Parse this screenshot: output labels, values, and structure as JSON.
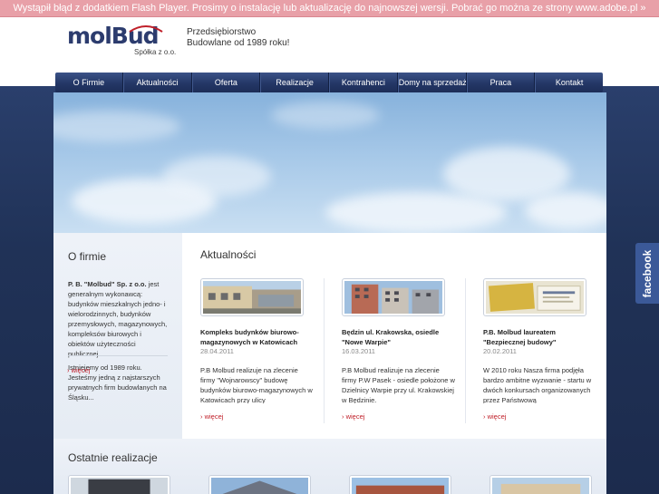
{
  "flash": {
    "message": "Wystąpił błąd z dodatkiem Flash Player. Prosimy o instalację lub aktualizację do najnowszej wersji. Pobrać go można ze strony",
    "link": "www.adobe.pl",
    "arrow": "»"
  },
  "header": {
    "logo_main": "mol",
    "logo_b": "B",
    "logo_rest": "ud",
    "logo_sub": "Spółka z o.o.",
    "tagline": "Przedsiębiorstwo Budowlane od 1989 roku!"
  },
  "nav": [
    "O Firmie",
    "Aktualności",
    "Oferta",
    "Realizacje",
    "Kontrahenci",
    "Domy na sprzedaż",
    "Praca",
    "Kontakt"
  ],
  "sidebar": {
    "title": "O firmie",
    "p1_bold": "P. B. \"Molbud\" Sp. z o.o.",
    "p1": " jest generalnym wykonawcą: budynków mieszkalnych jedno- i wielorodzinnych, budynków przemysłowych, magazynowych, kompleksów biurowych i obiektów użyteczności publicznej.",
    "p2": "Istniejemy od 1989 roku. Jesteśmy jedną z najstarszych prywatnych firm budowlanych na Śląsku...",
    "more": "› więcej"
  },
  "news": {
    "title": "Aktualności",
    "items": [
      {
        "headline": "Kompleks budynków biurowo-magazynowych w Katowicach",
        "date": "28.04.2011",
        "text": "P.B Molbud realizuje na zlecenie firmy \"Wojnarowscy\" budowę budynków biurowo-magazynowych w Katowicach przy ulicy",
        "more": "› więcej"
      },
      {
        "headline": "Będzin ul. Krakowska, osiedle \"Nowe Warpie\"",
        "date": "16.03.2011",
        "text": "P.B Molbud realizuje na zlecenie firmy P.W Pasek - osiedle położone w Dzielnicy Warpie przy ul. Krakowskiej w Będzinie.",
        "more": "› więcej"
      },
      {
        "headline": "P.B. Molbud laureatem \"Bezpiecznej budowy\"",
        "date": "20.02.2011",
        "text": "W 2010 roku Nasza firma podjęła bardzo ambitne wyzwanie - startu w dwóch konkursach organizowanych przez Państwową",
        "more": "› więcej"
      }
    ]
  },
  "recent": {
    "title": "Ostatnie realizacje"
  },
  "facebook": {
    "label": "facebook"
  },
  "colors": {
    "brand": "#2c3c6e",
    "nav": "#243766",
    "accent": "#c0202a",
    "facebook": "#3b5998",
    "flash_bar": "#e8a0a8"
  }
}
